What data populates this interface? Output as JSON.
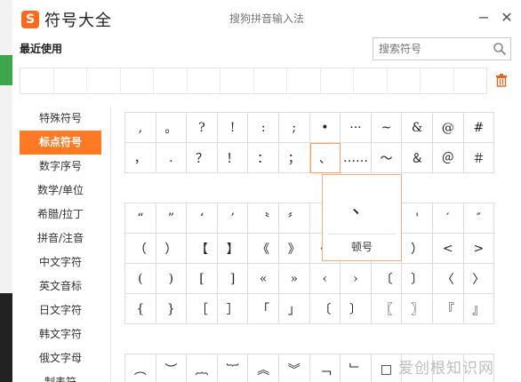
{
  "app": {
    "logo": "S",
    "title": "符号大全",
    "window_title": "搜狗拼音输入法",
    "minimize": "−",
    "close": "✕"
  },
  "recent": {
    "label": "最近使用",
    "cells": 14
  },
  "search": {
    "placeholder": "搜索符号"
  },
  "sidebar": {
    "items": [
      {
        "label": "特殊符号",
        "active": false
      },
      {
        "label": "标点符号",
        "active": true
      },
      {
        "label": "数字序号",
        "active": false
      },
      {
        "label": "数学/单位",
        "active": false
      },
      {
        "label": "希腊/拉丁",
        "active": false
      },
      {
        "label": "拼音/注音",
        "active": false
      },
      {
        "label": "中文字符",
        "active": false
      },
      {
        "label": "英文音标",
        "active": false
      },
      {
        "label": "日文字符",
        "active": false
      },
      {
        "label": "韩文字符",
        "active": false
      },
      {
        "label": "俄文字母",
        "active": false
      },
      {
        "label": "制表符",
        "active": false
      }
    ]
  },
  "grid1": [
    ",",
    "。",
    "?",
    "!",
    ":",
    ";",
    "•",
    "···",
    "~",
    "&",
    "@",
    "#",
    "，",
    ".",
    "？",
    "！",
    "：",
    "；",
    "、",
    "……",
    "～",
    "＆",
    "＠",
    "＃"
  ],
  "grid2": [
    "“",
    "”",
    "‘",
    "’",
    "〝",
    "〞",
    "",
    "",
    "",
    "'",
    "′",
    "″",
    "（",
    "）",
    "【",
    "】",
    "《",
    "》",
    "<",
    "",
    "",
    "）",
    "<",
    ">",
    "(",
    ")",
    "[",
    "]",
    "«",
    "»",
    "‹",
    "›",
    "〔",
    "〕",
    "〈",
    "〉",
    "{",
    "}",
    "［",
    "］",
    "「",
    "」",
    "〔",
    "〕",
    "〖",
    "〗",
    "『",
    "』"
  ],
  "grid3": [
    "︵",
    "︶",
    "︷",
    "︸",
    "︽",
    "︾",
    "﹁",
    "﹂",
    "□",
    "",
    "",
    ""
  ],
  "popup": {
    "symbol": "、",
    "name": "顿号"
  },
  "watermark": "爱创根知识网"
}
